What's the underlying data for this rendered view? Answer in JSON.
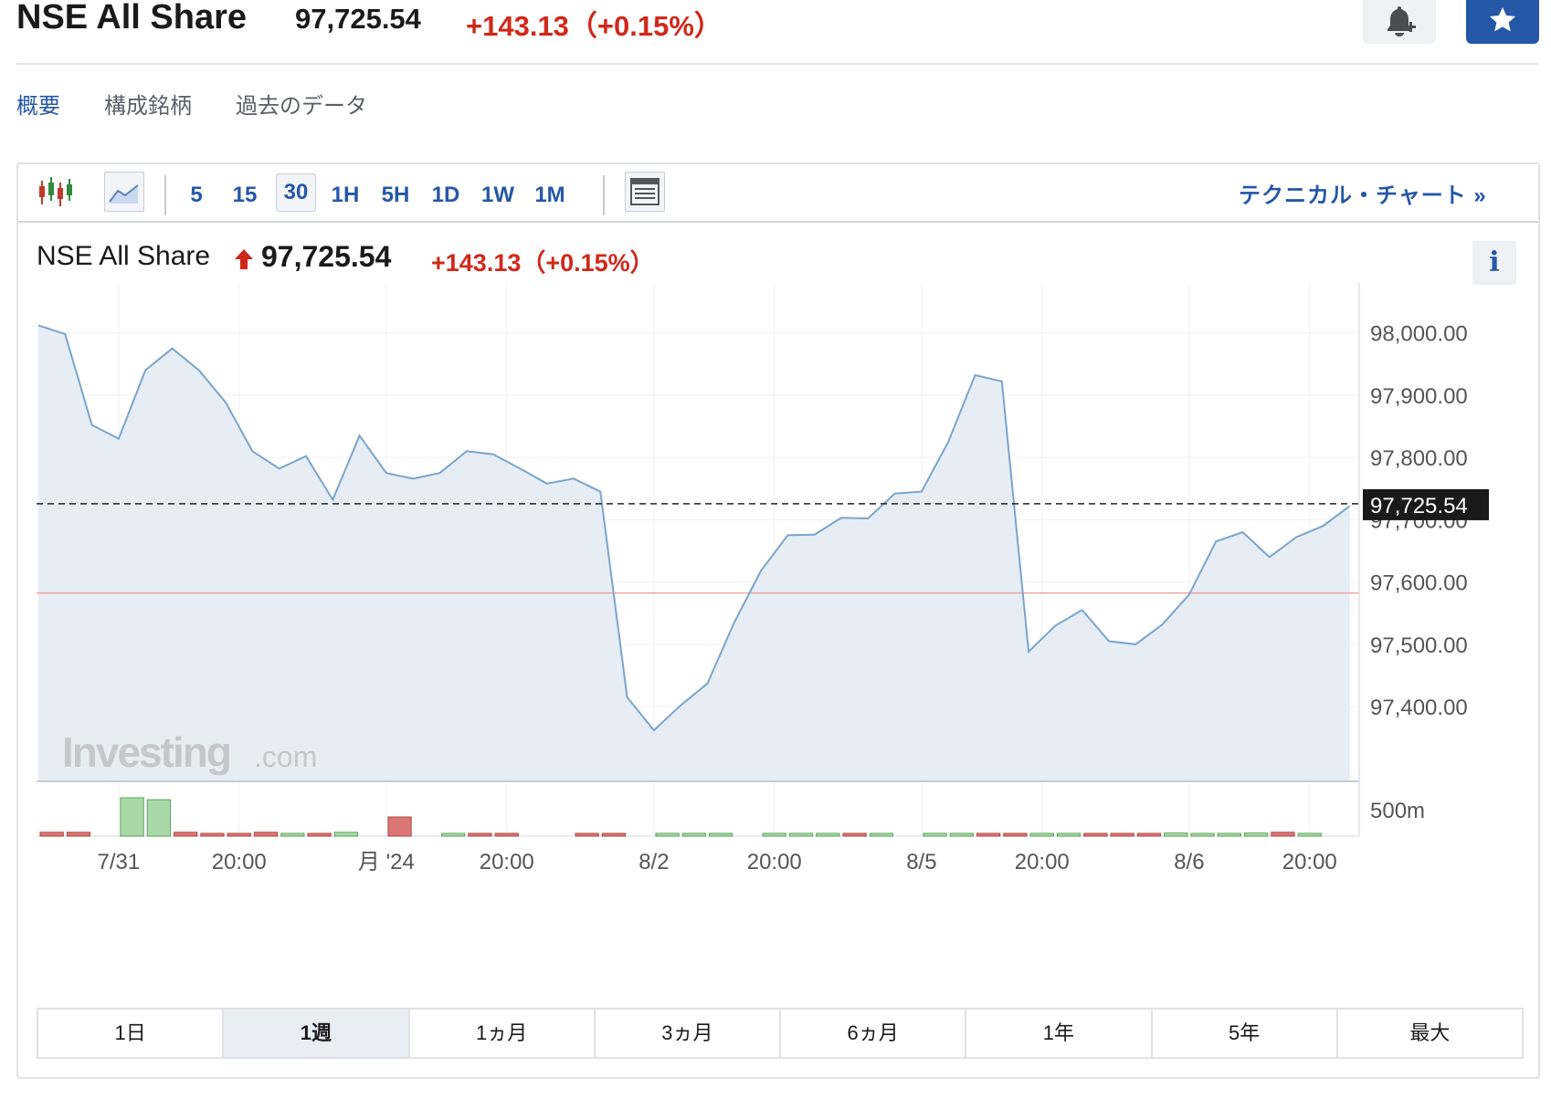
{
  "header": {
    "title": "NSE All Share",
    "price": "97,725.54",
    "change": "+143.13（+0.15%）"
  },
  "subtabs": [
    "概要",
    "構成銘柄",
    "過去のデータ"
  ],
  "toolbar": {
    "intervals": [
      "5",
      "15",
      "30",
      "1H",
      "5H",
      "1D",
      "1W",
      "1M"
    ],
    "active_interval": "30",
    "technical_link": "テクニカル・チャート »"
  },
  "quote": {
    "name": "NSE All Share",
    "price": "97,725.54",
    "change": "+143.13（+0.15%）",
    "info_label": "i"
  },
  "watermark": {
    "brand": "Investing",
    "suffix": ".com"
  },
  "colors": {
    "accent": "#2557a7",
    "up_red": "#d0281a",
    "line": "#7aa4cc",
    "area": "#e7edf5",
    "vol_up": "#a8d8a8",
    "vol_down": "#dc7674"
  },
  "chart_data": {
    "type": "area",
    "y_ticks": [
      "98,000.00",
      "97,900.00",
      "97,800.00",
      "97,700.00",
      "97,600.00",
      "97,500.00",
      "97,400.00"
    ],
    "y_tick_values": [
      98000,
      97900,
      97800,
      97700,
      97600,
      97500,
      97400
    ],
    "ylim": [
      97280,
      98080
    ],
    "current_value": 97725.54,
    "current_label": "97,725.54",
    "previous_close": 97582.41,
    "x_labels": [
      {
        "label": "7/31",
        "i": 3
      },
      {
        "label": "20:00",
        "i": 7.5
      },
      {
        "label": "月 '24",
        "i": 13
      },
      {
        "label": "20:00",
        "i": 17.5
      },
      {
        "label": "8/2",
        "i": 23
      },
      {
        "label": "20:00",
        "i": 27.5
      },
      {
        "label": "8/5",
        "i": 33
      },
      {
        "label": "20:00",
        "i": 37.5
      },
      {
        "label": "8/6",
        "i": 43
      },
      {
        "label": "20:00",
        "i": 47.5
      }
    ],
    "values": [
      98012,
      97998,
      97852,
      97830,
      97940,
      97975,
      97940,
      97888,
      97810,
      97782,
      97802,
      97732,
      97835,
      97775,
      97766,
      97775,
      97810,
      97805,
      97782,
      97758,
      97766,
      97745,
      97415,
      97362,
      97402,
      97437,
      97535,
      97618,
      97675,
      97676,
      97703,
      97702,
      97742,
      97745,
      97825,
      97932,
      97922,
      97488,
      97530,
      97555,
      97505,
      97500,
      97532,
      97580,
      97665,
      97680,
      97640,
      97672,
      97690,
      97722
    ],
    "volume_label": "500m",
    "volume": [
      {
        "i": 0,
        "v": 0.1,
        "up": false
      },
      {
        "i": 1,
        "v": 0.1,
        "up": false
      },
      {
        "i": 3,
        "v": 1.0,
        "up": true
      },
      {
        "i": 4,
        "v": 0.95,
        "up": true
      },
      {
        "i": 5,
        "v": 0.1,
        "up": false
      },
      {
        "i": 6,
        "v": 0.05,
        "up": false
      },
      {
        "i": 7,
        "v": 0.05,
        "up": false
      },
      {
        "i": 8,
        "v": 0.1,
        "up": false
      },
      {
        "i": 9,
        "v": 0.05,
        "up": true
      },
      {
        "i": 10,
        "v": 0.05,
        "up": false
      },
      {
        "i": 11,
        "v": 0.1,
        "up": true
      },
      {
        "i": 13,
        "v": 0.5,
        "up": false
      },
      {
        "i": 15,
        "v": 0.05,
        "up": true
      },
      {
        "i": 16,
        "v": 0.05,
        "up": false
      },
      {
        "i": 17,
        "v": 0.05,
        "up": false
      },
      {
        "i": 20,
        "v": 0.05,
        "up": false
      },
      {
        "i": 21,
        "v": 0.05,
        "up": false
      },
      {
        "i": 23,
        "v": 0.05,
        "up": true
      },
      {
        "i": 24,
        "v": 0.05,
        "up": true
      },
      {
        "i": 25,
        "v": 0.05,
        "up": true
      },
      {
        "i": 27,
        "v": 0.05,
        "up": true
      },
      {
        "i": 28,
        "v": 0.05,
        "up": true
      },
      {
        "i": 29,
        "v": 0.05,
        "up": true
      },
      {
        "i": 30,
        "v": 0.05,
        "up": false
      },
      {
        "i": 31,
        "v": 0.05,
        "up": true
      },
      {
        "i": 33,
        "v": 0.05,
        "up": true
      },
      {
        "i": 34,
        "v": 0.05,
        "up": true
      },
      {
        "i": 35,
        "v": 0.05,
        "up": false
      },
      {
        "i": 36,
        "v": 0.05,
        "up": false
      },
      {
        "i": 37,
        "v": 0.05,
        "up": true
      },
      {
        "i": 38,
        "v": 0.05,
        "up": true
      },
      {
        "i": 39,
        "v": 0.05,
        "up": false
      },
      {
        "i": 40,
        "v": 0.05,
        "up": false
      },
      {
        "i": 41,
        "v": 0.05,
        "up": false
      },
      {
        "i": 42,
        "v": 0.08,
        "up": true
      },
      {
        "i": 43,
        "v": 0.05,
        "up": true
      },
      {
        "i": 44,
        "v": 0.05,
        "up": true
      },
      {
        "i": 45,
        "v": 0.08,
        "up": true
      },
      {
        "i": 46,
        "v": 0.1,
        "up": false
      },
      {
        "i": 47,
        "v": 0.05,
        "up": true
      }
    ]
  },
  "ranges": [
    "1日",
    "1週",
    "1ヵ月",
    "3ヵ月",
    "6ヵ月",
    "1年",
    "5年",
    "最大"
  ],
  "active_range": "1週"
}
